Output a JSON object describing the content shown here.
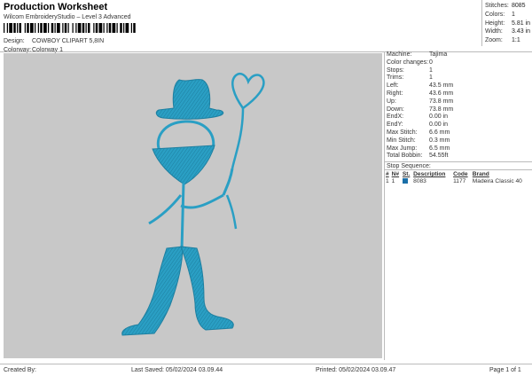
{
  "header": {
    "title": "Production Worksheet",
    "subtitle": "Wilcom EmbroideryStudio – Level 3 Advanced",
    "barcode_mark": ","
  },
  "design_meta": [
    {
      "label": "Design:",
      "value": "COWBOY CLIPART 5,8IN"
    },
    {
      "label": "Colorway:",
      "value": "Colorway 1"
    }
  ],
  "stats": [
    {
      "label": "Stitches:",
      "value": "8085"
    },
    {
      "label": "Colors:",
      "value": "1"
    },
    {
      "label": "Height:",
      "value": "5.81 in"
    },
    {
      "label": "Width:",
      "value": "3.43 in"
    },
    {
      "label": "Zoom:",
      "value": "1:1"
    }
  ],
  "machine_info": [
    {
      "label": "Machine:",
      "value": "Tajima"
    },
    {
      "label": "Color changes:",
      "value": "0"
    },
    {
      "label": "Stops:",
      "value": "1"
    },
    {
      "label": "Trims:",
      "value": "1"
    },
    {
      "label": "Left:",
      "value": "43.5 mm"
    },
    {
      "label": "Right:",
      "value": "43.6 mm"
    },
    {
      "label": "Up:",
      "value": "73.8 mm"
    },
    {
      "label": "Down:",
      "value": "73.8 mm"
    },
    {
      "label": "EndX:",
      "value": "0.00 in"
    },
    {
      "label": "EndY:",
      "value": "0.00 in"
    },
    {
      "label": "Max Stitch:",
      "value": "6.6 mm"
    },
    {
      "label": "Min Stitch:",
      "value": "0.3 mm"
    },
    {
      "label": "Max Jump:",
      "value": "6.5 mm"
    },
    {
      "label": "Total Bobbin:",
      "value": "54.55ft"
    }
  ],
  "stop_sequence": {
    "title": "Stop Sequence:",
    "columns": [
      "#",
      "N#",
      "St.",
      "Description",
      "Code",
      "Brand"
    ],
    "rows": [
      {
        "num": "1",
        "n": "1",
        "color": "#1a6fa8",
        "description": "8083",
        "code": "1177",
        "brand": "Madeira Classic 40"
      }
    ]
  },
  "design_colors": {
    "thread": "#2a9fc4",
    "background": "#c8c8c8"
  },
  "footer": {
    "created_by": "Created By:",
    "last_saved": "Last Saved: 05/02/2024 03.09.44",
    "printed": "Printed: 05/02/2024 03.09.47",
    "page": "Page 1 of 1"
  }
}
